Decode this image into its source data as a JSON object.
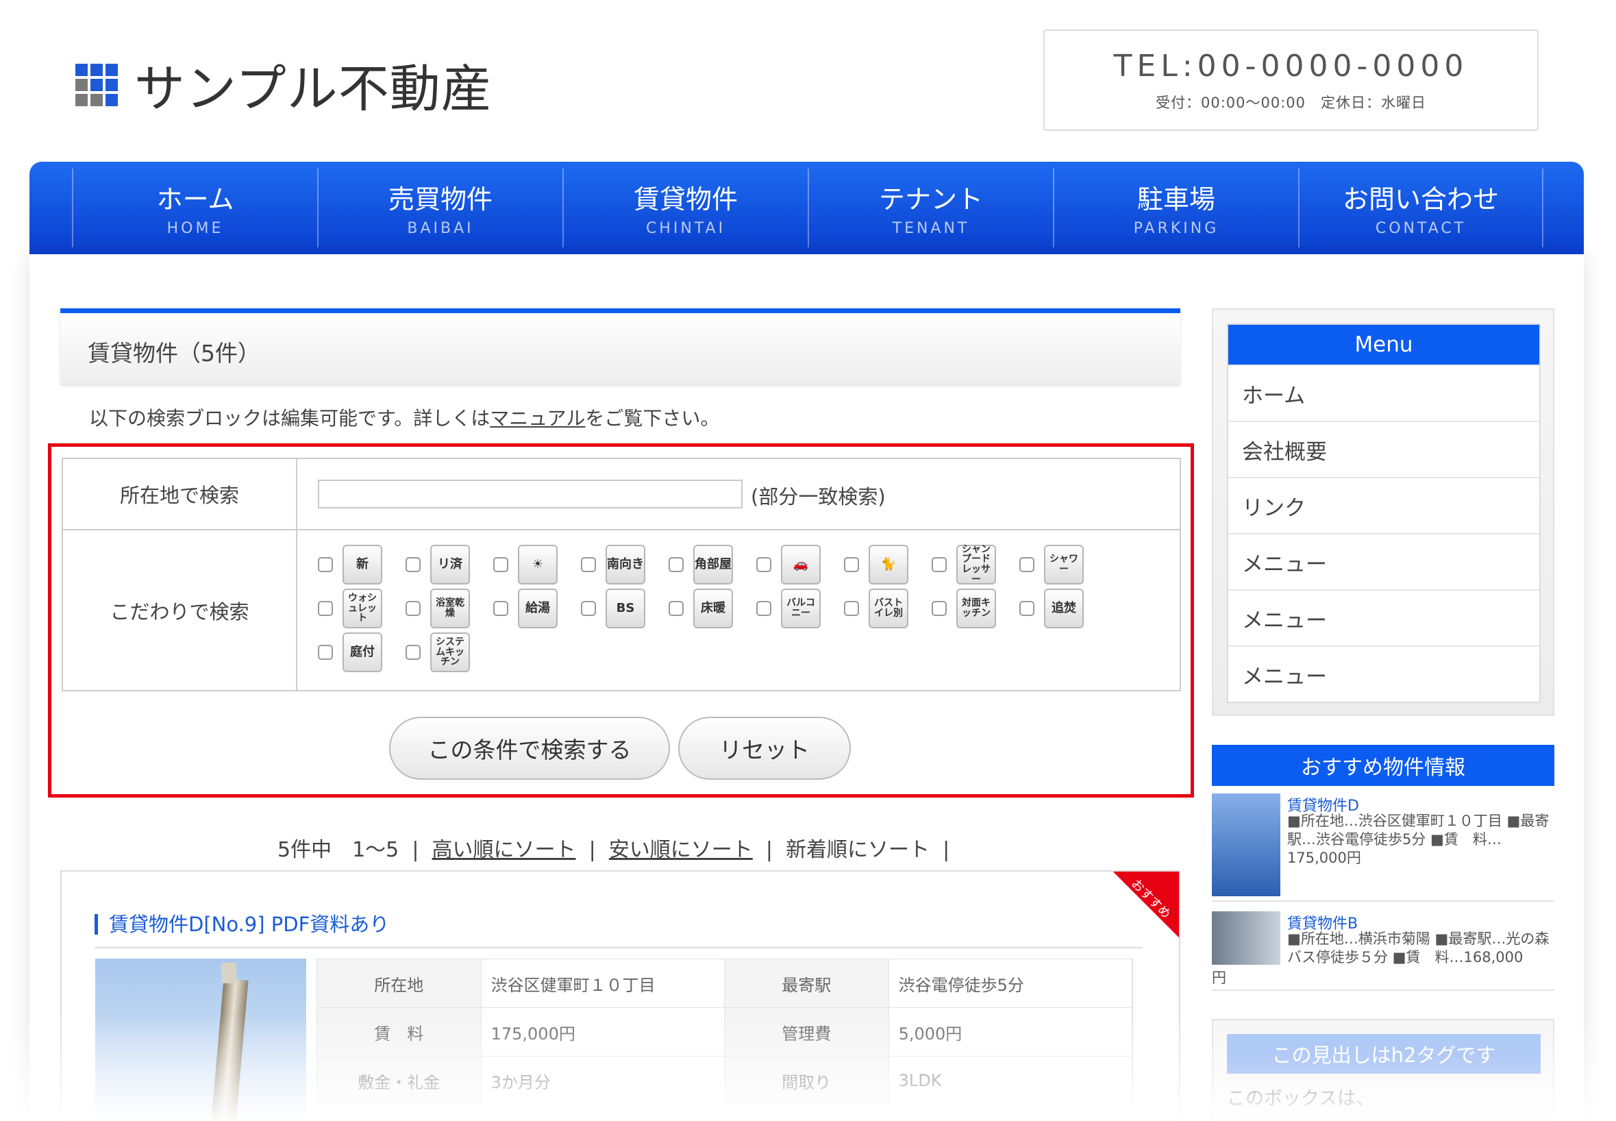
{
  "header": {
    "site_name": "サンプル不動産",
    "tel": "TEL:00-0000-0000",
    "hours": "受付：00:00〜00:00　定休日：水曜日"
  },
  "nav": {
    "items": [
      {
        "ja": "ホーム",
        "en": "HOME"
      },
      {
        "ja": "売買物件",
        "en": "BAIBAI"
      },
      {
        "ja": "賃貸物件",
        "en": "CHINTAI"
      },
      {
        "ja": "テナント",
        "en": "TENANT"
      },
      {
        "ja": "駐車場",
        "en": "PARKING"
      },
      {
        "ja": "お問い合わせ",
        "en": "CONTACT"
      }
    ]
  },
  "main": {
    "title": "賃貸物件（5件）",
    "intro_before": "以下の検索ブロックは編集可能です。詳しくは",
    "intro_link": "マニュアル",
    "intro_after": "をご覧下さい。",
    "search": {
      "location_label": "所在地で検索",
      "location_value": "",
      "location_note": "(部分一致検索)",
      "features_label": "こだわりで検索",
      "features": [
        "新",
        "リ済",
        "☀",
        "南向き",
        "角部屋",
        "🚗",
        "🐈",
        "シャンプードレッサー",
        "シャワー",
        "ウォシュレット",
        "浴室乾燥",
        "給湯",
        "BS",
        "床暖",
        "バルコニー",
        "バストイレ別",
        "対面キッチン",
        "追焚",
        "庭付",
        "システムキッチン"
      ],
      "submit_label": "この条件で検索する",
      "reset_label": "リセット"
    },
    "sort": {
      "count": "5件中　1〜5",
      "high": "高い順にソート",
      "low": "安い順にソート",
      "new": "新着順にソート"
    },
    "result": {
      "ribbon": "おすすめ",
      "title": "賃貸物件D[No.9] PDF資料あり",
      "rows": [
        {
          "l1": "所在地",
          "v1": "渋谷区健軍町１０丁目",
          "l2": "最寄駅",
          "v2": "渋谷電停徒歩5分"
        },
        {
          "l1": "賃　料",
          "v1": "175,000円",
          "l2": "管理費",
          "v2": "5,000円"
        },
        {
          "l1": "敷金・礼金",
          "v1": "3か月分",
          "l2": "間取り",
          "v2": "3LDK"
        }
      ]
    }
  },
  "sidebar": {
    "menu_title": "Menu",
    "menu_items": [
      "ホーム",
      "会社概要",
      "リンク",
      "メニュー",
      "メニュー",
      "メニュー"
    ],
    "recommend_title": "おすすめ物件情報",
    "recommend": [
      {
        "title": "賃貸物件D",
        "desc": "■所在地…渋谷区健軍町１０丁目 ■最寄駅…渋谷電停徒歩5分 ■賃　料…175,000円"
      },
      {
        "title": "賃貸物件B",
        "desc": "■所在地…横浜市菊陽 ■最寄駅…光の森バス停徒歩５分 ■賃　料…168,000",
        "tail": "円"
      }
    ],
    "h2box_title": "この見出しはh2タグです",
    "h2box_text": "このボックスは、"
  },
  "colors": {
    "accent": "#0b5cf0",
    "highlight_frame": "#e60012",
    "link": "#1a5cd6"
  }
}
